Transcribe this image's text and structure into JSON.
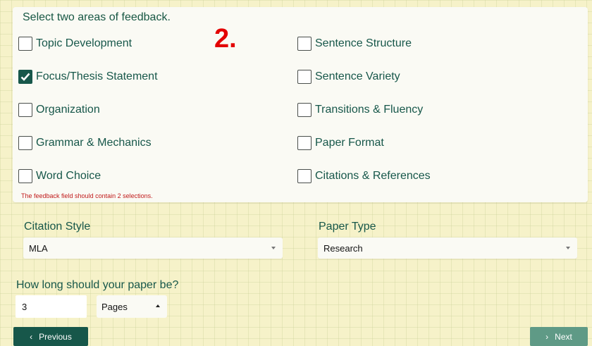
{
  "feedback": {
    "heading": "Select two areas of feedback.",
    "step_number": "2.",
    "options": [
      {
        "label": "Topic Development",
        "checked": false
      },
      {
        "label": "Focus/Thesis Statement",
        "checked": true
      },
      {
        "label": "Organization",
        "checked": false
      },
      {
        "label": "Grammar & Mechanics",
        "checked": false
      },
      {
        "label": "Word Choice",
        "checked": false
      },
      {
        "label": "Sentence Structure",
        "checked": false
      },
      {
        "label": "Sentence Variety",
        "checked": false
      },
      {
        "label": "Transitions & Fluency",
        "checked": false
      },
      {
        "label": "Paper Format",
        "checked": false
      },
      {
        "label": "Citations & References",
        "checked": false
      }
    ],
    "error": "The feedback field should contain 2 selections."
  },
  "citation": {
    "label": "Citation Style",
    "value": "MLA"
  },
  "paper_type": {
    "label": "Paper Type",
    "value": "Research"
  },
  "length": {
    "question": "How long should your paper be?",
    "value": "3",
    "unit": "Pages"
  },
  "nav": {
    "previous_label": "Previous",
    "next_label": "Next"
  },
  "colors": {
    "accent": "#17574a",
    "next_button": "#5f9a86",
    "error": "#c01a1a",
    "step_number": "#e30000"
  }
}
